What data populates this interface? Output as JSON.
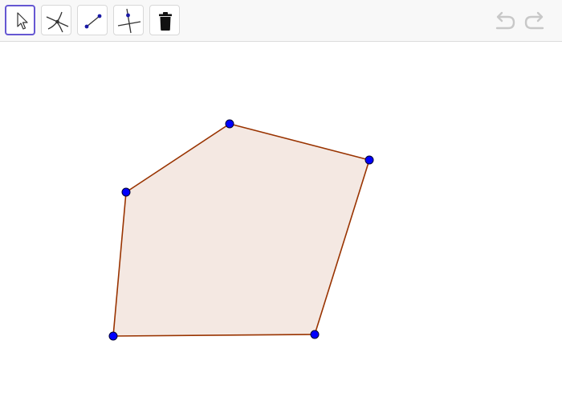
{
  "toolbar": {
    "tools": [
      {
        "name": "move",
        "icon": "cursor-arrow-icon",
        "selected": true
      },
      {
        "name": "intersect",
        "icon": "intersect-icon",
        "selected": false
      },
      {
        "name": "segment",
        "icon": "segment-icon",
        "selected": false
      },
      {
        "name": "perpendicular-line",
        "icon": "perpendicular-line-icon",
        "selected": false
      },
      {
        "name": "delete",
        "icon": "trash-icon",
        "selected": false
      }
    ],
    "history": {
      "undo_icon": "undo-icon",
      "redo_icon": "redo-icon",
      "enabled": false
    }
  },
  "construction": {
    "shape": "pentagon",
    "vertex_count": 5,
    "colors": {
      "polygon_fill": "#f4e8e2",
      "polygon_stroke": "#993300",
      "point_fill": "#0000ff",
      "point_stroke": "#000033",
      "selected_tool_border": "#6557d2"
    }
  }
}
